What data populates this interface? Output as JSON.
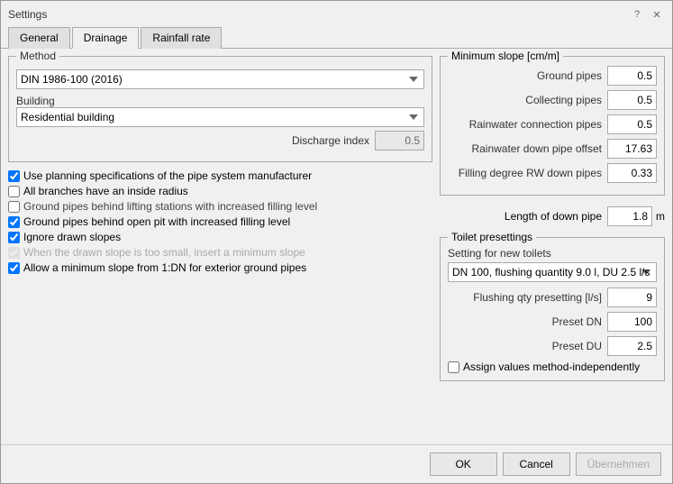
{
  "dialog": {
    "title": "Settings",
    "help_btn": "?",
    "close_btn": "✕"
  },
  "tabs": [
    {
      "label": "General",
      "active": false
    },
    {
      "label": "Drainage",
      "active": true
    },
    {
      "label": "Rainfall rate",
      "active": false
    }
  ],
  "left": {
    "method_group": "Method",
    "method_value": "DIN 1986-100 (2016)",
    "building_label": "Building",
    "building_value": "Residential building",
    "discharge_label": "Discharge index",
    "discharge_value": "0.5",
    "checkboxes": [
      {
        "id": "cb1",
        "label": "Use planning specifications of the pipe system manufacturer",
        "checked": true,
        "disabled": false
      },
      {
        "id": "cb2",
        "label": "All branches have an inside radius",
        "checked": false,
        "disabled": false
      },
      {
        "id": "cb3",
        "label": "Ground pipes behind lifting stations with increased filling level",
        "checked": false,
        "disabled": false
      },
      {
        "id": "cb4",
        "label": "Ground pipes behind open pit with increased filling level",
        "checked": true,
        "disabled": false
      },
      {
        "id": "cb5",
        "label": "Ignore drawn slopes",
        "checked": true,
        "disabled": false
      },
      {
        "id": "cb6",
        "label": "When the drawn slope is too small, insert a minimum slope",
        "checked": true,
        "disabled": true
      },
      {
        "id": "cb7",
        "label": "Allow a minimum slope from 1:DN for exterior ground pipes",
        "checked": true,
        "disabled": false
      }
    ]
  },
  "right": {
    "min_slope_title": "Minimum slope [cm/m]",
    "slope_fields": [
      {
        "label": "Ground pipes",
        "value": "0.5"
      },
      {
        "label": "Collecting pipes",
        "value": "0.5"
      },
      {
        "label": "Rainwater connection pipes",
        "value": "0.5"
      },
      {
        "label": "Rainwater down pipe offset",
        "value": "17.63"
      },
      {
        "label": "Filling degree RW down pipes",
        "value": "0.33"
      }
    ],
    "downpipe_label": "Length of down pipe",
    "downpipe_value": "1.8",
    "downpipe_unit": "m",
    "toilet_title": "Toilet presettings",
    "toilet_preset_label": "Setting for new toilets",
    "toilet_dropdown": "DN 100, flushing quantity 9.0 l, DU 2.5 l/s",
    "toilet_fields": [
      {
        "label": "Flushing qty presetting [l/s]",
        "value": "9"
      },
      {
        "label": "Preset DN",
        "value": "100"
      },
      {
        "label": "Preset DU",
        "value": "2.5"
      }
    ],
    "assign_label": "Assign values method-independently"
  },
  "buttons": {
    "ok": "OK",
    "cancel": "Cancel",
    "apply": "Übernehmen"
  }
}
